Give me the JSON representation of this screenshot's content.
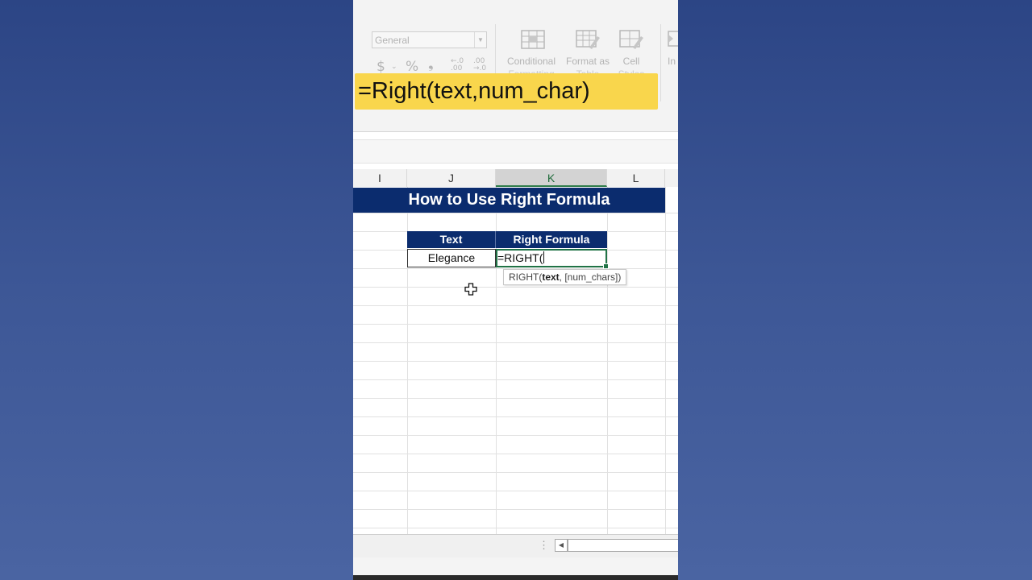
{
  "ribbon": {
    "number_format": "General",
    "currency_symbol": "$",
    "percent_symbol": "%",
    "comma_symbol": "❟",
    "decrease_decimal": "←.0\n.00",
    "increase_decimal": ".00\n→.0",
    "conditional_formatting_label": "Conditional",
    "conditional_formatting_sub": "Formatting",
    "format_as_table_label": "Format as",
    "format_as_table_sub": "Table",
    "cell_styles_label": "Cell",
    "cell_styles_sub": "Styles",
    "insert_label": "In"
  },
  "banner": {
    "formula": "=Right(text,num_char)"
  },
  "columns": [
    {
      "label": "I",
      "selected": false
    },
    {
      "label": "J",
      "selected": false
    },
    {
      "label": "K",
      "selected": true
    },
    {
      "label": "L",
      "selected": false
    }
  ],
  "sheet": {
    "title": "How to Use Right Formula",
    "header_text": "Text",
    "header_formula": "Right Formula",
    "cell_text": "Elegance",
    "cell_formula": "=RIGHT(",
    "tooltip_fn": "RIGHT(",
    "tooltip_arg1": "text",
    "tooltip_rest": ", [num_chars])"
  },
  "colors": {
    "header_fill": "#0b2c6e",
    "banner_fill": "#f9d64c",
    "active_cell_border": "#217346"
  },
  "icons": {
    "cursor": "cell-select-cross-icon"
  }
}
